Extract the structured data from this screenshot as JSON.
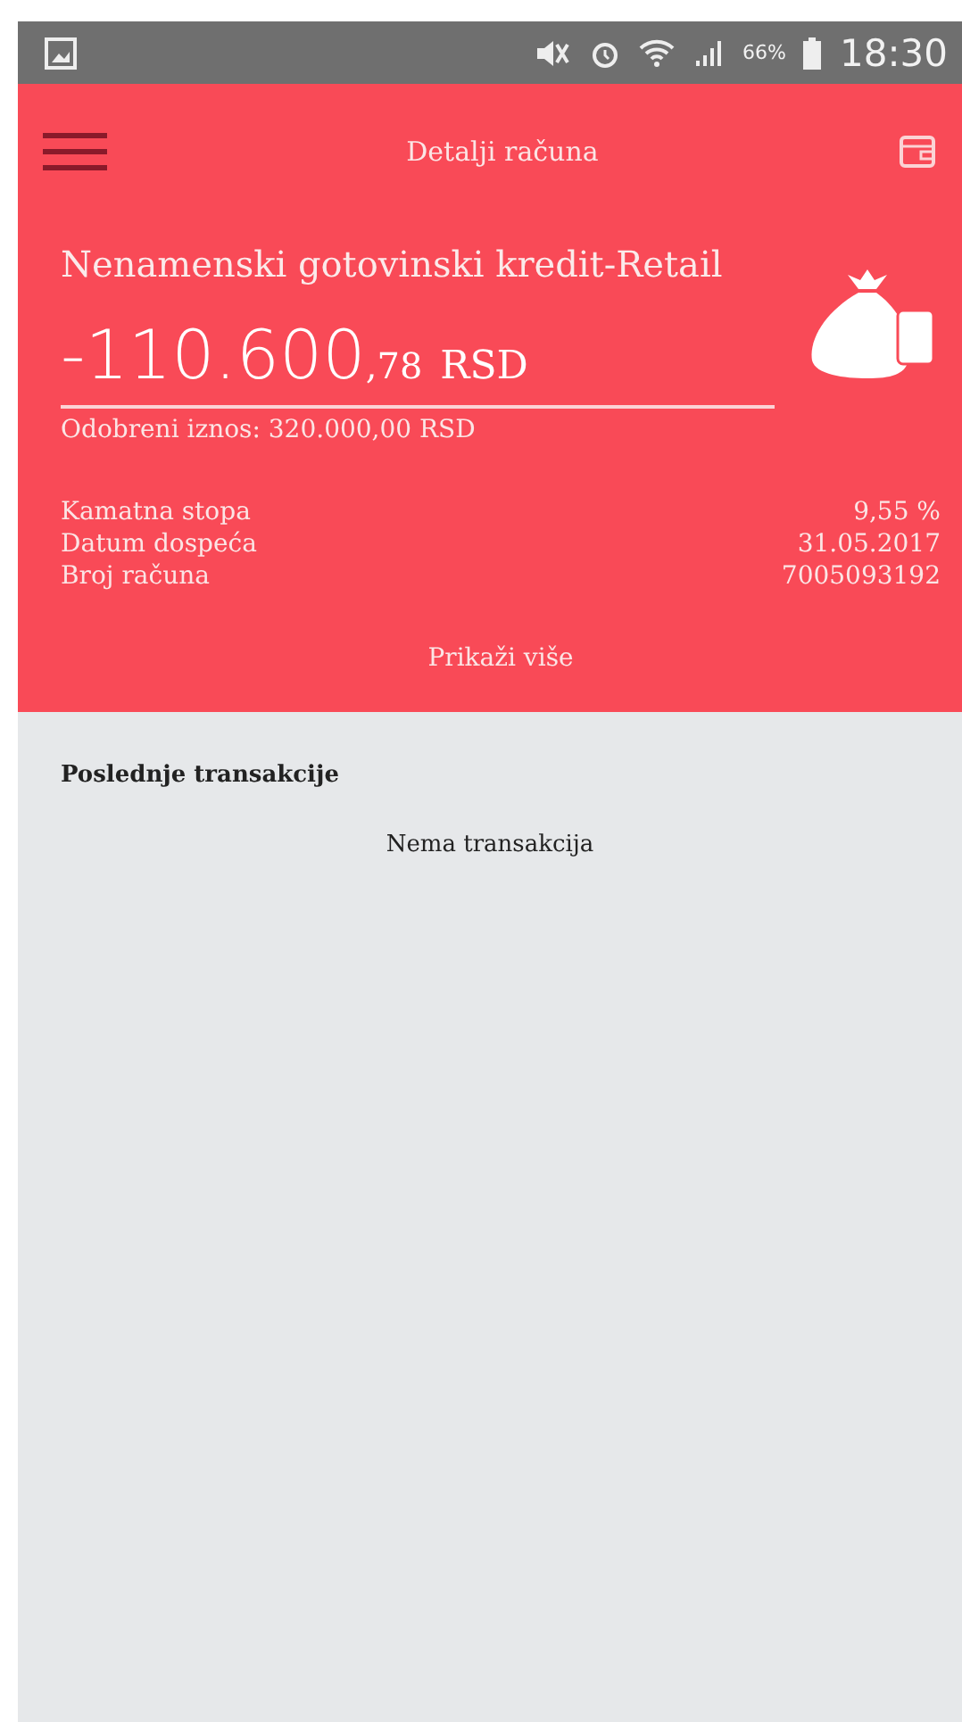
{
  "status_bar": {
    "battery": "66%",
    "time": "18:30"
  },
  "header": {
    "title": "Detalji računa"
  },
  "account": {
    "name": "Nenamenski gotovinski kredit-Retail",
    "amount_main": "-110.600",
    "amount_decimals": ",78",
    "currency": "RSD",
    "approved": "Odobreni iznos: 320.000,00 RSD"
  },
  "details": [
    {
      "label": "Kamatna stopa",
      "value": "9,55 %"
    },
    {
      "label": "Datum dospeća",
      "value": "31.05.2017"
    },
    {
      "label": "Broj računa",
      "value": "7005093192"
    }
  ],
  "show_more": "Prikaži više",
  "transactions": {
    "title": "Poslednje transakcije",
    "empty": "Nema transakcija"
  }
}
